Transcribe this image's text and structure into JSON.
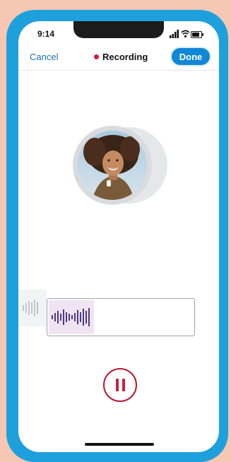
{
  "status_bar": {
    "time": "9:14",
    "icons": [
      "signal-icon",
      "wifi-icon",
      "battery-icon"
    ]
  },
  "nav": {
    "cancel_label": "Cancel",
    "recording_label": "Recording",
    "done_label": "Done"
  },
  "colors": {
    "accent": "#1188d6",
    "record": "#d51c3b",
    "frame": "#1ea0dd",
    "background": "#f6c7b3",
    "waveform": "#4b3a86"
  },
  "controls": {
    "pause_icon": "pause-icon"
  }
}
